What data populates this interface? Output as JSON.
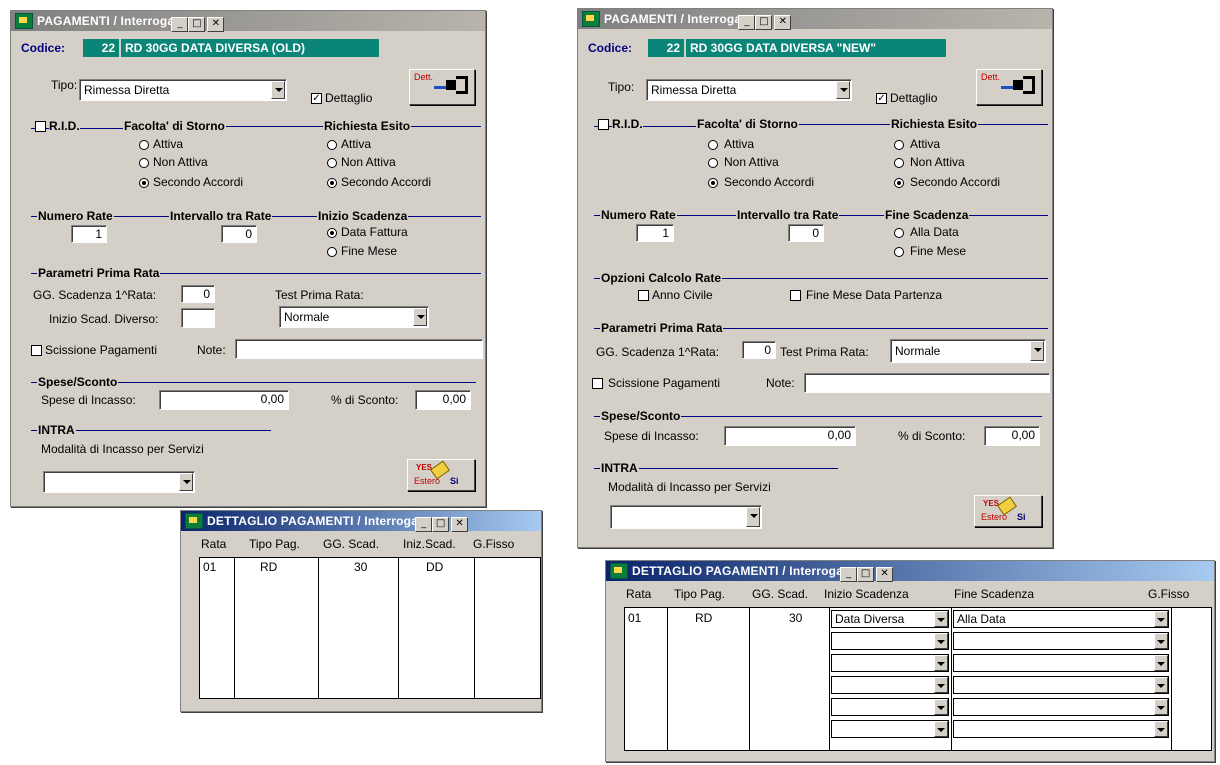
{
  "left": {
    "window_title": "PAGAMENTI / Interroga",
    "codice_label": "Codice:",
    "codice_num": "22",
    "codice_desc": "RD 30GG DATA DIVERSA (OLD)",
    "tipo_label": "Tipo:",
    "tipo_value": "Rimessa Diretta",
    "dettaglio_label": "Dettaglio",
    "dett_btn": "Dett.",
    "rid_label": "R.I.D.",
    "storno_label": "Facolta' di Storno",
    "esito_label": "Richiesta Esito",
    "opt_attiva": "Attiva",
    "opt_non_attiva": "Non Attiva",
    "opt_secondo": "Secondo Accordi",
    "numero_rate_label": "Numero Rate",
    "numero_rate_value": "1",
    "intervallo_label": "Intervallo tra Rate",
    "intervallo_value": "0",
    "inizio_label": "Inizio Scadenza",
    "opt_data_fattura": "Data Fattura",
    "opt_fine_mese": "Fine Mese",
    "prima_rata_label": "Parametri Prima Rata",
    "gg_scad_label": "GG. Scadenza 1^Rata:",
    "gg_scad_value": "0",
    "inizio_diverso_label": "Inizio Scad. Diverso:",
    "test_prima_label": "Test Prima Rata:",
    "test_prima_value": "Normale",
    "scissione_label": "Scissione Pagamenti",
    "note_label": "Note:",
    "spese_sconto_label": "Spese/Sconto",
    "spese_incasso_label": "Spese di Incasso:",
    "spese_incasso_value": "0,00",
    "sconto_label": "% di Sconto:",
    "sconto_value": "0,00",
    "intra_label": "INTRA",
    "modalita_label": "Modalità di Incasso per Servizi",
    "estero_yes": "YES",
    "estero_label": "Estero",
    "estero_si": "Si"
  },
  "right": {
    "window_title": "PAGAMENTI / Interroga",
    "codice_label": "Codice:",
    "codice_num": "22",
    "codice_desc": "RD 30GG DATA DIVERSA \"NEW\"",
    "tipo_label": "Tipo:",
    "tipo_value": "Rimessa Diretta",
    "dettaglio_label": "Dettaglio",
    "dett_btn": "Dett.",
    "rid_label": "R.I.D.",
    "storno_label": "Facolta' di Storno",
    "esito_label": "Richiesta Esito",
    "opt_attiva": "Attiva",
    "opt_non_attiva": "Non Attiva",
    "opt_secondo": "Secondo Accordi",
    "numero_rate_label": "Numero Rate",
    "numero_rate_value": "1",
    "intervallo_label": "Intervallo tra Rate",
    "intervallo_value": "0",
    "fine_label": "Fine Scadenza",
    "opt_alla_data": "Alla Data",
    "opt_fine_mese": "Fine Mese",
    "opzioni_label": "Opzioni Calcolo Rate",
    "anno_civile_label": "Anno Civile",
    "fine_mese_partenza_label": "Fine Mese Data Partenza",
    "prima_rata_label": "Parametri Prima Rata",
    "gg_scad_label": "GG. Scadenza 1^Rata:",
    "gg_scad_value": "0",
    "test_prima_label": "Test Prima Rata:",
    "test_prima_value": "Normale",
    "scissione_label": "Scissione Pagamenti",
    "note_label": "Note:",
    "spese_sconto_label": "Spese/Sconto",
    "spese_incasso_label": "Spese di Incasso:",
    "spese_incasso_value": "0,00",
    "sconto_label": "% di Sconto:",
    "sconto_value": "0,00",
    "intra_label": "INTRA",
    "modalita_label": "Modalità di Incasso per Servizi",
    "estero_yes": "YES",
    "estero_label": "Estero",
    "estero_si": "Si"
  },
  "detail_left": {
    "window_title": "DETTAGLIO PAGAMENTI / Interroga",
    "headers": [
      "Rata",
      "Tipo Pag.",
      "GG. Scad.",
      "Iniz.Scad.",
      "G.Fisso"
    ],
    "row": [
      "01",
      "RD",
      "30",
      "DD",
      ""
    ]
  },
  "detail_right": {
    "window_title": "DETTAGLIO PAGAMENTI / Interroga",
    "headers": [
      "Rata",
      "Tipo Pag.",
      "GG. Scad.",
      "Inizio Scadenza",
      "Fine Scadenza",
      "G.Fisso"
    ],
    "row": [
      "01",
      "RD",
      "30",
      "Data Diversa",
      "Alla Data",
      ""
    ]
  },
  "colors": {
    "code_bg": "#0b8577",
    "face": "#d4d0c8",
    "section_line": "#000080"
  }
}
